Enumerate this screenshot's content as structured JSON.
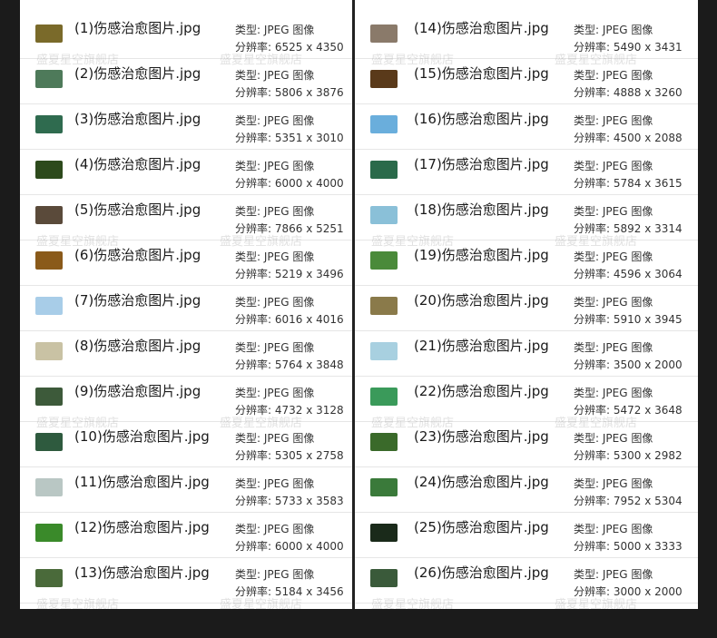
{
  "watermark": "盛夏星空旗舰店",
  "labels": {
    "type_prefix": "类型: ",
    "res_prefix": "分辨率: "
  },
  "files": [
    {
      "name": "(1)伤感治愈图片.jpg",
      "type": "JPEG 图像",
      "res": "6525 x 4350",
      "thumb_color": "#7a6a2a"
    },
    {
      "name": "(2)伤感治愈图片.jpg",
      "type": "JPEG 图像",
      "res": "5806 x 3876",
      "thumb_color": "#4e7a5a"
    },
    {
      "name": "(3)伤感治愈图片.jpg",
      "type": "JPEG 图像",
      "res": "5351 x 3010",
      "thumb_color": "#2f6b4f"
    },
    {
      "name": "(4)伤感治愈图片.jpg",
      "type": "JPEG 图像",
      "res": "6000 x 4000",
      "thumb_color": "#2d4a1c"
    },
    {
      "name": "(5)伤感治愈图片.jpg",
      "type": "JPEG 图像",
      "res": "7866 x 5251",
      "thumb_color": "#5a4a3a"
    },
    {
      "name": "(6)伤感治愈图片.jpg",
      "type": "JPEG 图像",
      "res": "5219 x 3496",
      "thumb_color": "#8a5a1a"
    },
    {
      "name": "(7)伤感治愈图片.jpg",
      "type": "JPEG 图像",
      "res": "6016 x 4016",
      "thumb_color": "#a8cde8"
    },
    {
      "name": "(8)伤感治愈图片.jpg",
      "type": "JPEG 图像",
      "res": "5764 x 3848",
      "thumb_color": "#c9c2a4"
    },
    {
      "name": "(9)伤感治愈图片.jpg",
      "type": "JPEG 图像",
      "res": "4732 x 3128",
      "thumb_color": "#3d5a3a"
    },
    {
      "name": "(10)伤感治愈图片.jpg",
      "type": "JPEG 图像",
      "res": "5305 x 2758",
      "thumb_color": "#2e5a3e"
    },
    {
      "name": "(11)伤感治愈图片.jpg",
      "type": "JPEG 图像",
      "res": "5733 x 3583",
      "thumb_color": "#b9c7c4"
    },
    {
      "name": "(12)伤感治愈图片.jpg",
      "type": "JPEG 图像",
      "res": "6000 x 4000",
      "thumb_color": "#3a8a2a"
    },
    {
      "name": "(13)伤感治愈图片.jpg",
      "type": "JPEG 图像",
      "res": "5184 x 3456",
      "thumb_color": "#4a6a3a"
    },
    {
      "name": "(14)伤感治愈图片.jpg",
      "type": "JPEG 图像",
      "res": "5490 x 3431",
      "thumb_color": "#8a7a6a"
    },
    {
      "name": "(15)伤感治愈图片.jpg",
      "type": "JPEG 图像",
      "res": "4888 x 3260",
      "thumb_color": "#5a3a1a"
    },
    {
      "name": "(16)伤感治愈图片.jpg",
      "type": "JPEG 图像",
      "res": "4500 x 2088",
      "thumb_color": "#6aaedc"
    },
    {
      "name": "(17)伤感治愈图片.jpg",
      "type": "JPEG 图像",
      "res": "5784 x 3615",
      "thumb_color": "#2a6a4a"
    },
    {
      "name": "(18)伤感治愈图片.jpg",
      "type": "JPEG 图像",
      "res": "5892 x 3314",
      "thumb_color": "#8ac0d8"
    },
    {
      "name": "(19)伤感治愈图片.jpg",
      "type": "JPEG 图像",
      "res": "4596 x 3064",
      "thumb_color": "#4a8a3a"
    },
    {
      "name": "(20)伤感治愈图片.jpg",
      "type": "JPEG 图像",
      "res": "5910 x 3945",
      "thumb_color": "#8a7a4a"
    },
    {
      "name": "(21)伤感治愈图片.jpg",
      "type": "JPEG 图像",
      "res": "3500 x 2000",
      "thumb_color": "#a8d0e0"
    },
    {
      "name": "(22)伤感治愈图片.jpg",
      "type": "JPEG 图像",
      "res": "5472 x 3648",
      "thumb_color": "#3a9a5a"
    },
    {
      "name": "(23)伤感治愈图片.jpg",
      "type": "JPEG 图像",
      "res": "5300 x 2982",
      "thumb_color": "#3a6a2a"
    },
    {
      "name": "(24)伤感治愈图片.jpg",
      "type": "JPEG 图像",
      "res": "7952 x 5304",
      "thumb_color": "#3a7a3a"
    },
    {
      "name": "(25)伤感治愈图片.jpg",
      "type": "JPEG 图像",
      "res": "5000 x 3333",
      "thumb_color": "#1a2a1a"
    },
    {
      "name": "(26)伤感治愈图片.jpg",
      "type": "JPEG 图像",
      "res": "3000 x 2000",
      "thumb_color": "#3a5a3a"
    }
  ]
}
